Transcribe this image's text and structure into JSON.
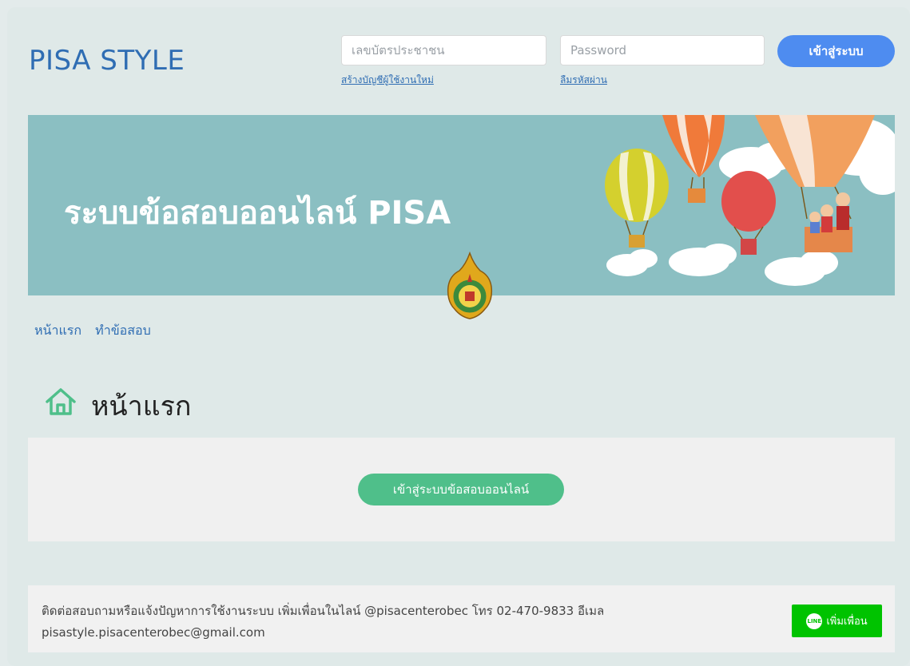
{
  "header": {
    "brand": "PISA STYLE",
    "id_placeholder": "เลขบัตรประชาชน",
    "password_placeholder": "Password",
    "register_link": "สร้างบัญชีผู้ใช้งานใหม่",
    "forgot_link": "ลืมรหัสผ่าน",
    "login_button": "เข้าสู่ระบบ"
  },
  "banner": {
    "title": "ระบบข้อสอบออนไลน์ PISA"
  },
  "nav": {
    "items": [
      "หน้าแรก",
      "ทำข้อสอบ"
    ]
  },
  "main": {
    "title": "หน้าแรก",
    "enter_button": "เข้าสู่ระบบข้อสอบออนไลน์"
  },
  "footer": {
    "contact_line1": "ติดต่อสอบถามหรือแจ้งปัญหาการใช้งานระบบ เพิ่มเพื่อนในไลน์ @pisacenterobec โทร 02-470-9833 อีเมล",
    "contact_line2": "pisastyle.pisacenterobec@gmail.com",
    "line_button": "เพิ่มเพื่อน",
    "line_badge": "LINE"
  },
  "colors": {
    "brand": "#2f6db3",
    "login_button": "#4e8cf0",
    "banner_bg": "#8bbfc2",
    "enter_button": "#4fbf8a",
    "line_green": "#00c300"
  }
}
